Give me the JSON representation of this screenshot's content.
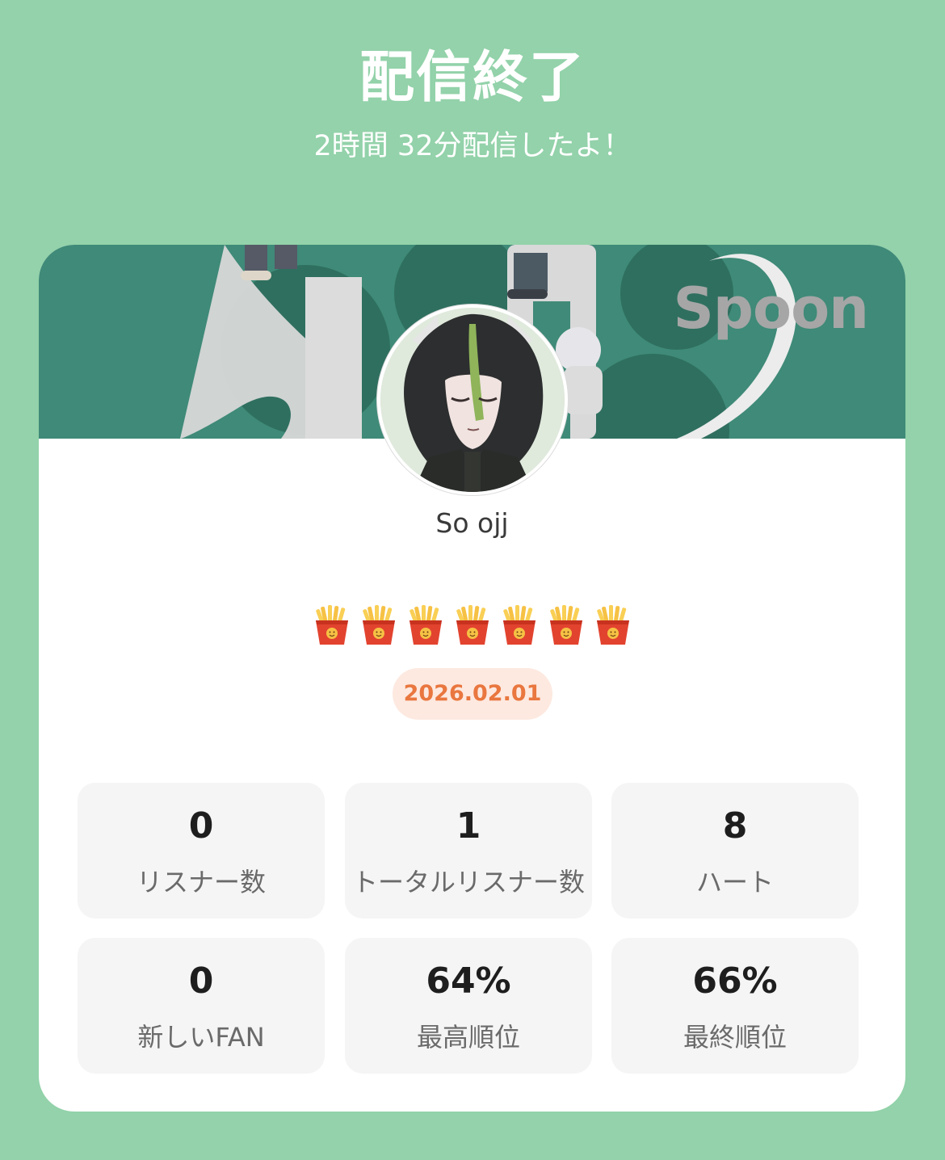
{
  "header": {
    "title": "配信終了",
    "subtitle": "2時間 32分配信したよ！"
  },
  "banner": {
    "logo_text": "Spoon",
    "background_color": "#3f8a78"
  },
  "profile": {
    "username": "So ojj",
    "avatar_icon": "avatar-image"
  },
  "fries": {
    "icon": "french-fries-emoji",
    "count": 7
  },
  "date": "2026.02.01",
  "stats": [
    {
      "value": "0",
      "label": "リスナー数"
    },
    {
      "value": "1",
      "label": "トータルリスナー数"
    },
    {
      "value": "8",
      "label": "ハート"
    },
    {
      "value": "0",
      "label": "新しいFAN"
    },
    {
      "value": "64%",
      "label": "最高順位"
    },
    {
      "value": "66%",
      "label": "最終順位"
    }
  ],
  "colors": {
    "page_background": "#93d2aa",
    "date_text": "#e9773f",
    "date_background": "#fde9e0"
  }
}
